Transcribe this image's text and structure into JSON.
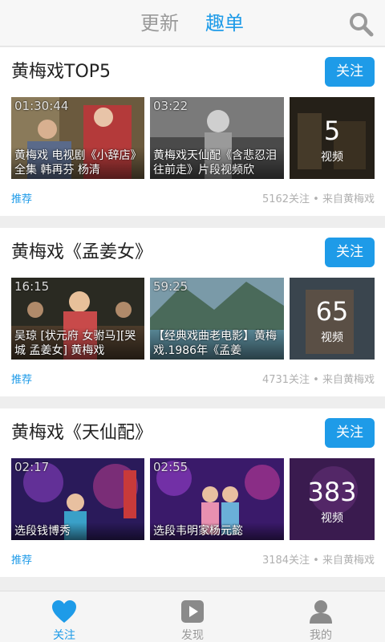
{
  "header": {
    "tabs": [
      {
        "label": "更新",
        "active": false
      },
      {
        "label": "趣单",
        "active": true
      }
    ],
    "search_icon": "search-icon",
    "accent_color": "#1e9be8"
  },
  "cards": [
    {
      "title": "黄梅戏TOP5",
      "follow_label": "关注",
      "videos": [
        {
          "duration": "01:30:44",
          "caption": "黄梅戏 电视剧《小辞店》全集 韩再芬 杨清"
        },
        {
          "duration": "03:22",
          "caption": "黄梅戏天仙配《含悲忍泪往前走》片段视频欣"
        }
      ],
      "count": "5",
      "count_label": "视频",
      "tag": "推荐",
      "meta": "5162关注 • 来自黄梅戏"
    },
    {
      "title": "黄梅戏《孟姜女》",
      "follow_label": "关注",
      "videos": [
        {
          "duration": "16:15",
          "caption": "吴琼 [状元府 女驸马][哭城 孟姜女] 黄梅戏"
        },
        {
          "duration": "59:25",
          "caption": "【经典戏曲老电影】黄梅戏.1986年《孟姜"
        }
      ],
      "count": "65",
      "count_label": "视频",
      "tag": "推荐",
      "meta": "4731关注 • 来自黄梅戏"
    },
    {
      "title": "黄梅戏《天仙配》",
      "follow_label": "关注",
      "videos": [
        {
          "duration": "02:17",
          "caption": "选段钱博秀"
        },
        {
          "duration": "02:55",
          "caption": "选段韦明家杨元懿"
        }
      ],
      "count": "383",
      "count_label": "视频",
      "tag": "推荐",
      "meta": "3184关注 • 来自黄梅戏"
    }
  ],
  "bottom_nav": [
    {
      "label": "关注",
      "icon": "heart-icon",
      "active": true
    },
    {
      "label": "发现",
      "icon": "play-icon",
      "active": false
    },
    {
      "label": "我的",
      "icon": "user-icon",
      "active": false
    }
  ]
}
